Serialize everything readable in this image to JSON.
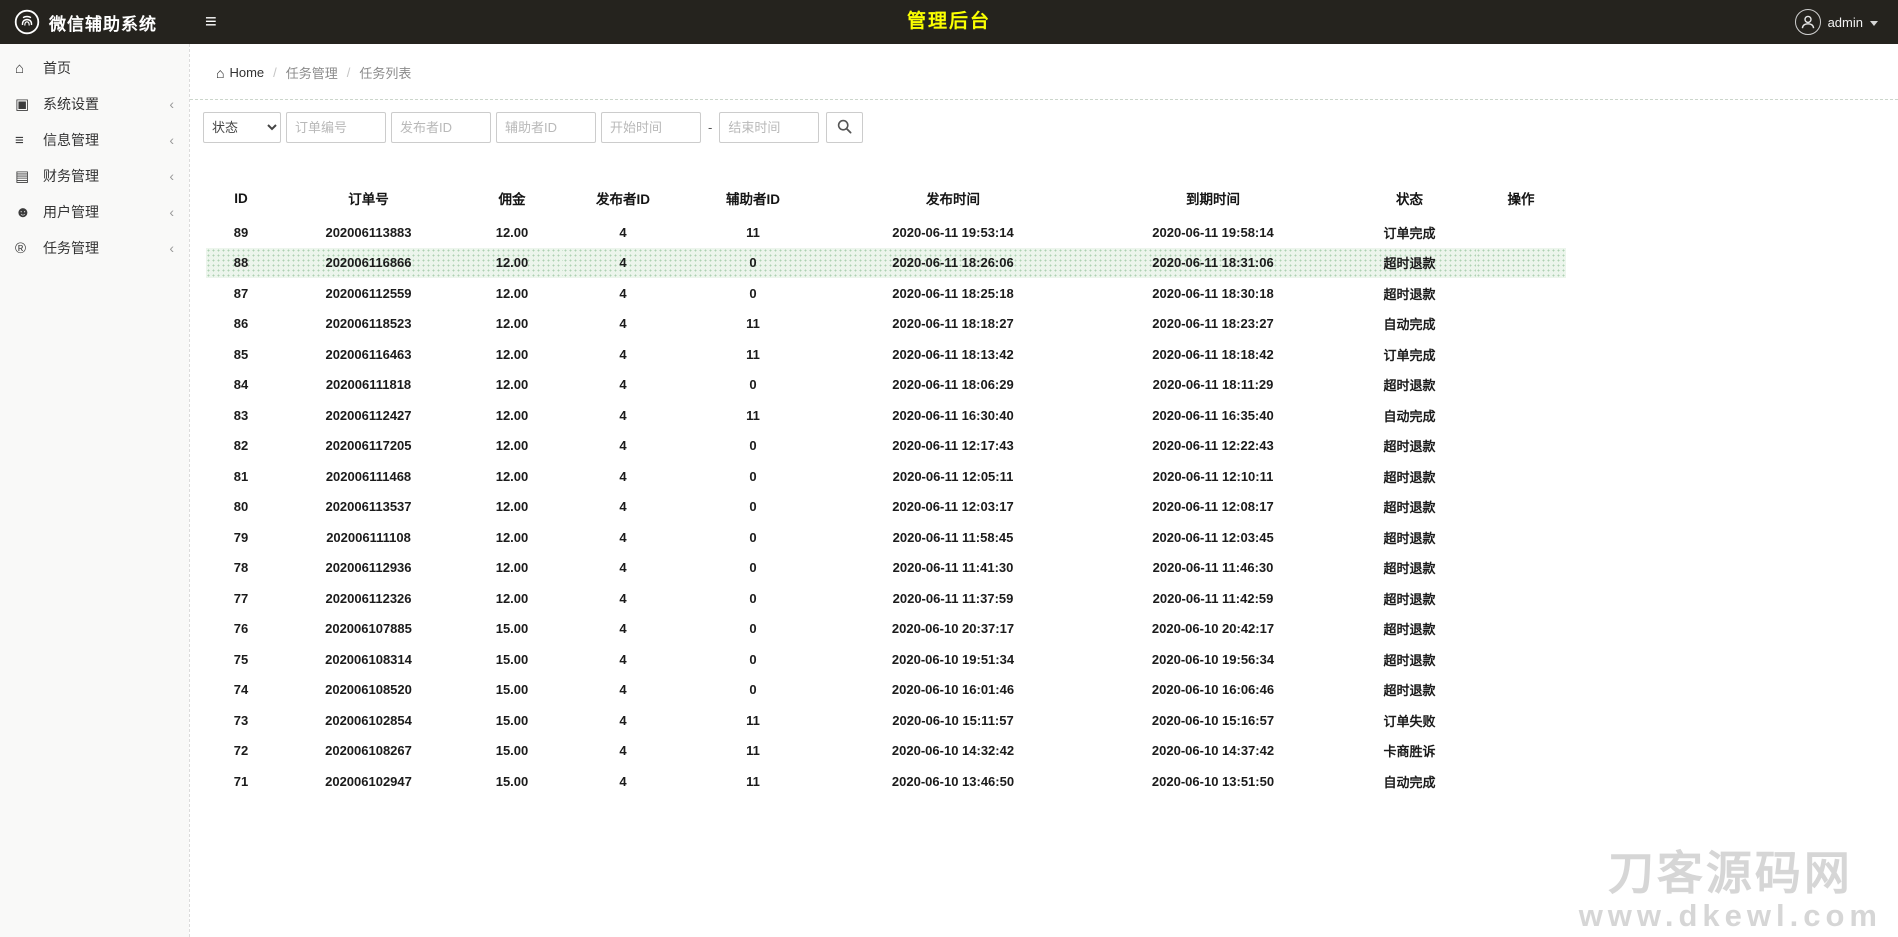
{
  "header": {
    "brand": "微信辅助系统",
    "title": "管理后台",
    "user_name": "admin",
    "colors": {
      "bar_bg": "#25231e",
      "title": "#fbff00"
    }
  },
  "sidebar": {
    "items": [
      {
        "label": "首页",
        "icon": "home-icon",
        "has_children": false
      },
      {
        "label": "系统设置",
        "icon": "system-settings-icon",
        "has_children": true
      },
      {
        "label": "信息管理",
        "icon": "info-management-icon",
        "has_children": true
      },
      {
        "label": "财务管理",
        "icon": "finance-icon",
        "has_children": true
      },
      {
        "label": "用户管理",
        "icon": "user-management-icon",
        "has_children": true
      },
      {
        "label": "任务管理",
        "icon": "task-management-icon",
        "has_children": true
      }
    ]
  },
  "breadcrumb": {
    "home": "Home",
    "separator": "/",
    "section": "任务管理",
    "page": "任务列表"
  },
  "filters": {
    "status_selected": "状态",
    "order_no_placeholder": "订单编号",
    "publisher_id_placeholder": "发布者ID",
    "assistant_id_placeholder": "辅助者ID",
    "start_time_placeholder": "开始时间",
    "range_separator": "-",
    "end_time_placeholder": "结束时间"
  },
  "table": {
    "columns": [
      "ID",
      "订单号",
      "佣金",
      "发布者ID",
      "辅助者ID",
      "发布时间",
      "到期时间",
      "状态",
      "操作"
    ],
    "rows": [
      {
        "id": "89",
        "order_no": "202006113883",
        "commission": "12.00",
        "publisher_id": "4",
        "assistant_id": "11",
        "publish_time": "2020-06-11 19:53:14",
        "expire_time": "2020-06-11 19:58:14",
        "status": "订单完成",
        "actions": "",
        "highlighted": false
      },
      {
        "id": "88",
        "order_no": "202006116866",
        "commission": "12.00",
        "publisher_id": "4",
        "assistant_id": "0",
        "publish_time": "2020-06-11 18:26:06",
        "expire_time": "2020-06-11 18:31:06",
        "status": "超时退款",
        "actions": "",
        "highlighted": true
      },
      {
        "id": "87",
        "order_no": "202006112559",
        "commission": "12.00",
        "publisher_id": "4",
        "assistant_id": "0",
        "publish_time": "2020-06-11 18:25:18",
        "expire_time": "2020-06-11 18:30:18",
        "status": "超时退款",
        "actions": "",
        "highlighted": false
      },
      {
        "id": "86",
        "order_no": "202006118523",
        "commission": "12.00",
        "publisher_id": "4",
        "assistant_id": "11",
        "publish_time": "2020-06-11 18:18:27",
        "expire_time": "2020-06-11 18:23:27",
        "status": "自动完成",
        "actions": "",
        "highlighted": false
      },
      {
        "id": "85",
        "order_no": "202006116463",
        "commission": "12.00",
        "publisher_id": "4",
        "assistant_id": "11",
        "publish_time": "2020-06-11 18:13:42",
        "expire_time": "2020-06-11 18:18:42",
        "status": "订单完成",
        "actions": "",
        "highlighted": false
      },
      {
        "id": "84",
        "order_no": "202006111818",
        "commission": "12.00",
        "publisher_id": "4",
        "assistant_id": "0",
        "publish_time": "2020-06-11 18:06:29",
        "expire_time": "2020-06-11 18:11:29",
        "status": "超时退款",
        "actions": "",
        "highlighted": false
      },
      {
        "id": "83",
        "order_no": "202006112427",
        "commission": "12.00",
        "publisher_id": "4",
        "assistant_id": "11",
        "publish_time": "2020-06-11 16:30:40",
        "expire_time": "2020-06-11 16:35:40",
        "status": "自动完成",
        "actions": "",
        "highlighted": false
      },
      {
        "id": "82",
        "order_no": "202006117205",
        "commission": "12.00",
        "publisher_id": "4",
        "assistant_id": "0",
        "publish_time": "2020-06-11 12:17:43",
        "expire_time": "2020-06-11 12:22:43",
        "status": "超时退款",
        "actions": "",
        "highlighted": false
      },
      {
        "id": "81",
        "order_no": "202006111468",
        "commission": "12.00",
        "publisher_id": "4",
        "assistant_id": "0",
        "publish_time": "2020-06-11 12:05:11",
        "expire_time": "2020-06-11 12:10:11",
        "status": "超时退款",
        "actions": "",
        "highlighted": false
      },
      {
        "id": "80",
        "order_no": "202006113537",
        "commission": "12.00",
        "publisher_id": "4",
        "assistant_id": "0",
        "publish_time": "2020-06-11 12:03:17",
        "expire_time": "2020-06-11 12:08:17",
        "status": "超时退款",
        "actions": "",
        "highlighted": false
      },
      {
        "id": "79",
        "order_no": "202006111108",
        "commission": "12.00",
        "publisher_id": "4",
        "assistant_id": "0",
        "publish_time": "2020-06-11 11:58:45",
        "expire_time": "2020-06-11 12:03:45",
        "status": "超时退款",
        "actions": "",
        "highlighted": false
      },
      {
        "id": "78",
        "order_no": "202006112936",
        "commission": "12.00",
        "publisher_id": "4",
        "assistant_id": "0",
        "publish_time": "2020-06-11 11:41:30",
        "expire_time": "2020-06-11 11:46:30",
        "status": "超时退款",
        "actions": "",
        "highlighted": false
      },
      {
        "id": "77",
        "order_no": "202006112326",
        "commission": "12.00",
        "publisher_id": "4",
        "assistant_id": "0",
        "publish_time": "2020-06-11 11:37:59",
        "expire_time": "2020-06-11 11:42:59",
        "status": "超时退款",
        "actions": "",
        "highlighted": false
      },
      {
        "id": "76",
        "order_no": "202006107885",
        "commission": "15.00",
        "publisher_id": "4",
        "assistant_id": "0",
        "publish_time": "2020-06-10 20:37:17",
        "expire_time": "2020-06-10 20:42:17",
        "status": "超时退款",
        "actions": "",
        "highlighted": false
      },
      {
        "id": "75",
        "order_no": "202006108314",
        "commission": "15.00",
        "publisher_id": "4",
        "assistant_id": "0",
        "publish_time": "2020-06-10 19:51:34",
        "expire_time": "2020-06-10 19:56:34",
        "status": "超时退款",
        "actions": "",
        "highlighted": false
      },
      {
        "id": "74",
        "order_no": "202006108520",
        "commission": "15.00",
        "publisher_id": "4",
        "assistant_id": "0",
        "publish_time": "2020-06-10 16:01:46",
        "expire_time": "2020-06-10 16:06:46",
        "status": "超时退款",
        "actions": "",
        "highlighted": false
      },
      {
        "id": "73",
        "order_no": "202006102854",
        "commission": "15.00",
        "publisher_id": "4",
        "assistant_id": "11",
        "publish_time": "2020-06-10 15:11:57",
        "expire_time": "2020-06-10 15:16:57",
        "status": "订单失败",
        "actions": "",
        "highlighted": false
      },
      {
        "id": "72",
        "order_no": "202006108267",
        "commission": "15.00",
        "publisher_id": "4",
        "assistant_id": "11",
        "publish_time": "2020-06-10 14:32:42",
        "expire_time": "2020-06-10 14:37:42",
        "status": "卡商胜诉",
        "actions": "",
        "highlighted": false
      },
      {
        "id": "71",
        "order_no": "202006102947",
        "commission": "15.00",
        "publisher_id": "4",
        "assistant_id": "11",
        "publish_time": "2020-06-10 13:46:50",
        "expire_time": "2020-06-10 13:51:50",
        "status": "自动完成",
        "actions": "",
        "highlighted": false
      }
    ]
  },
  "watermark": {
    "site": "刀客源码网",
    "url": "www.dkewl.com"
  }
}
